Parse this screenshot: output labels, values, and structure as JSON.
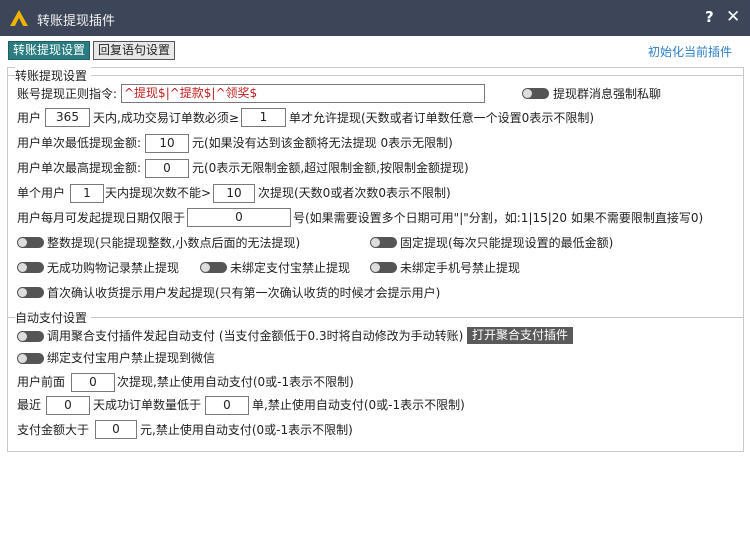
{
  "window": {
    "title": "转账提现插件",
    "help": "?",
    "close": "✕"
  },
  "tabs": [
    {
      "label": "转账提现设置"
    },
    {
      "label": "回复语句设置"
    }
  ],
  "init_link": "初始化当前插件",
  "transfer": {
    "group_label": "转账提现设置",
    "regex_label": "账号提现正则指令:",
    "regex_value": "^提现$|^提款$|^领奖$",
    "group_private_toggle": "提现群消息强制私聊",
    "row_user_prefix": "用户",
    "days_value": "365",
    "days_suffix": "天内,成功交易订单数必须≥",
    "orders_value": "1",
    "orders_suffix": "单才允许提现(天数或者订单数任意一个设置0表示不限制)",
    "min_label": "用户单次最低提现金额:",
    "min_value": "10",
    "min_suffix": "元(如果没有达到该金额将无法提现 0表示无限制)",
    "max_label": "用户单次最高提现金额:",
    "max_value": "0",
    "max_suffix": "元(0表示无限制金额,超过限制金额,按限制金额提现)",
    "single_user_label": "单个用户",
    "single_days_value": "1",
    "single_days_suffix": "天内提现次数不能>",
    "single_count_value": "10",
    "single_count_suffix": "次提现(天数0或者次数0表示不限制)",
    "month_label": "用户每月可发起提现日期仅限于",
    "month_value": "0",
    "month_suffix": "号(如果需要设置多个日期可用\"|\"分割，如:1|15|20 如果不需要限制直接写0)",
    "toggle_integer": "整数提现(只能提现整数,小数点后面的无法提现)",
    "toggle_fixed": "固定提现(每次只能提现设置的最低金额)",
    "toggle_no_purchase": "无成功购物记录禁止提现",
    "toggle_no_alipay": "未绑定支付宝禁止提现",
    "toggle_no_phone": "未绑定手机号禁止提现",
    "toggle_first_confirm": "首次确认收货提示用户发起提现(只有第一次确认收货的时候才会提示用户)"
  },
  "autopay": {
    "group_label": "自动支付设置",
    "toggle_aggregate": "调用聚合支付插件发起自动支付 (当支付金额低于0.3时将自动修改为手动转账)",
    "open_plugin_button": "打开聚合支付插件",
    "toggle_alipay_wechat": "绑定支付宝用户禁止提现到微信",
    "front_label": "用户前面",
    "front_value": "0",
    "front_suffix": "次提现,禁止使用自动支付(0或-1表示不限制)",
    "recent_label": "最近",
    "recent_days_value": "0",
    "recent_days_suffix": "天成功订单数量低于",
    "recent_orders_value": "0",
    "recent_orders_suffix": "单,禁止使用自动支付(0或-1表示不限制)",
    "amount_label": "支付金额大于",
    "amount_value": "0",
    "amount_suffix": "元,禁止使用自动支付(0或-1表示不限制)"
  }
}
